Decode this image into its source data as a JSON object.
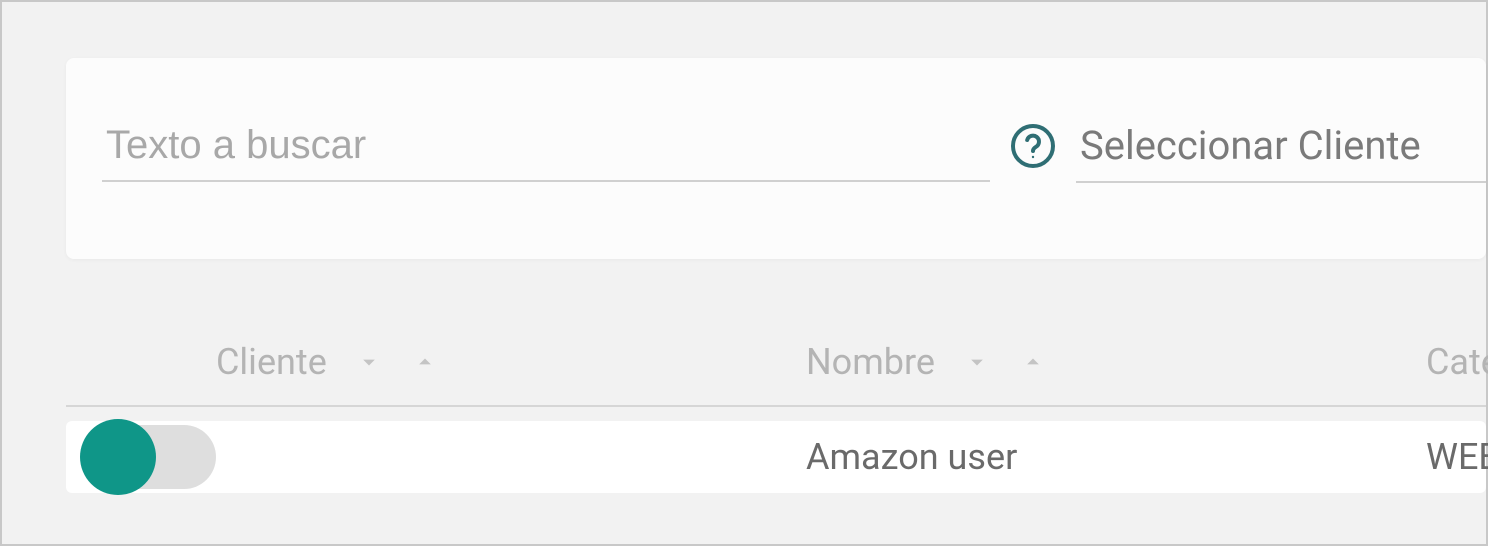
{
  "search": {
    "placeholder": "Texto a buscar"
  },
  "client_select": {
    "placeholder": "Seleccionar Cliente"
  },
  "table": {
    "columns": {
      "cliente": "Cliente",
      "nombre": "Nombre",
      "categoria": "Categoría"
    },
    "rows": [
      {
        "nombre": "Amazon user",
        "categoria": "WEB"
      }
    ]
  }
}
